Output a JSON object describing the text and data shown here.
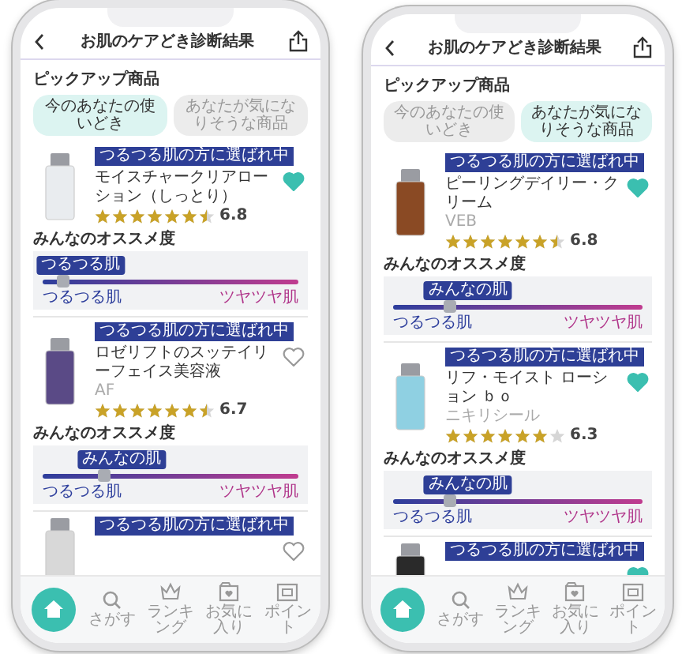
{
  "phones": [
    {
      "header": {
        "title": "お肌のケアどき診断結果"
      },
      "section_title": "ピックアップ商品",
      "tabs": [
        {
          "label": "今のあなたの使いどき",
          "selected": true
        },
        {
          "label": "あなたが気になりそうな商品",
          "selected": false
        }
      ],
      "products": [
        {
          "badge": "つるつる肌の方に選ばれ中",
          "name": "モイスチャークリアローション（しっとり）",
          "stars": 6.5,
          "score": "6.8",
          "liked": true,
          "color": "#e9ecef",
          "recommend_label": "みんなのオススメ度",
          "slider": {
            "marker": "つるつる肌",
            "left": "つるつる肌",
            "right": "ツヤツヤ肌",
            "level": 0.08
          }
        },
        {
          "badge": "つるつる肌の方に選ばれ中",
          "name": "ロゼリフトのスッテイリーフェイス美容液",
          "brand": "AF",
          "stars": 6.5,
          "score": "6.7",
          "liked": false,
          "color": "#5a4a86",
          "recommend_label": "みんなのオススメ度",
          "slider": {
            "marker": "みんなの肌",
            "left": "つるつる肌",
            "right": "ツヤツヤ肌",
            "level": 0.24
          }
        },
        {
          "badge": "つるつる肌の方に選ばれ中",
          "liked": false,
          "color": "#d8d8d8"
        }
      ],
      "nav": [
        {
          "kind": "home",
          "selected": true
        },
        {
          "kind": "search",
          "label": "さがす",
          "selected": false
        },
        {
          "kind": "ranking",
          "label": "ランキング",
          "selected": false
        },
        {
          "kind": "favorites",
          "label": "お気に入り",
          "selected": false
        },
        {
          "kind": "points",
          "label": "ポイント",
          "selected": false
        }
      ]
    },
    {
      "header": {
        "title": "お肌のケアどき診断結果"
      },
      "section_title": "ピックアップ商品",
      "tabs": [
        {
          "label": "今のあなたの使いどき",
          "selected": false
        },
        {
          "label": "あなたが気になりそうな商品",
          "selected": true
        }
      ],
      "products": [
        {
          "badge": "つるつる肌の方に選ばれ中",
          "name": "ピーリングデイリー・クリーム",
          "brand": "VEB",
          "stars": 6.5,
          "score": "6.8",
          "liked": true,
          "color": "#8a4a24",
          "recommend_label": "みんなのオススメ度",
          "slider": {
            "marker": "みんなの肌",
            "left": "つるつる肌",
            "right": "ツヤツヤ肌",
            "level": 0.23
          }
        },
        {
          "badge": "つるつる肌の方に選ばれ中",
          "name": "リフ・モイスト ローション ｂｏ",
          "brand": "ニキリシール",
          "stars": 6,
          "score": "6.3",
          "liked": true,
          "color": "#8fd0e2",
          "recommend_label": "みんなのオススメ度",
          "slider": {
            "marker": "みんなの肌",
            "left": "つるつる肌",
            "right": "ツヤツヤ肌",
            "level": 0.23
          }
        },
        {
          "badge": "つるつる肌の方に選ばれ中",
          "liked": true,
          "color": "#2a2a2a"
        }
      ],
      "nav": [
        {
          "kind": "home",
          "selected": true
        },
        {
          "kind": "search",
          "label": "さがす",
          "selected": false
        },
        {
          "kind": "ranking",
          "label": "ランキング",
          "selected": false
        },
        {
          "kind": "favorites",
          "label": "お気に入り",
          "selected": false
        },
        {
          "kind": "points",
          "label": "ポイント",
          "selected": false
        }
      ]
    }
  ]
}
